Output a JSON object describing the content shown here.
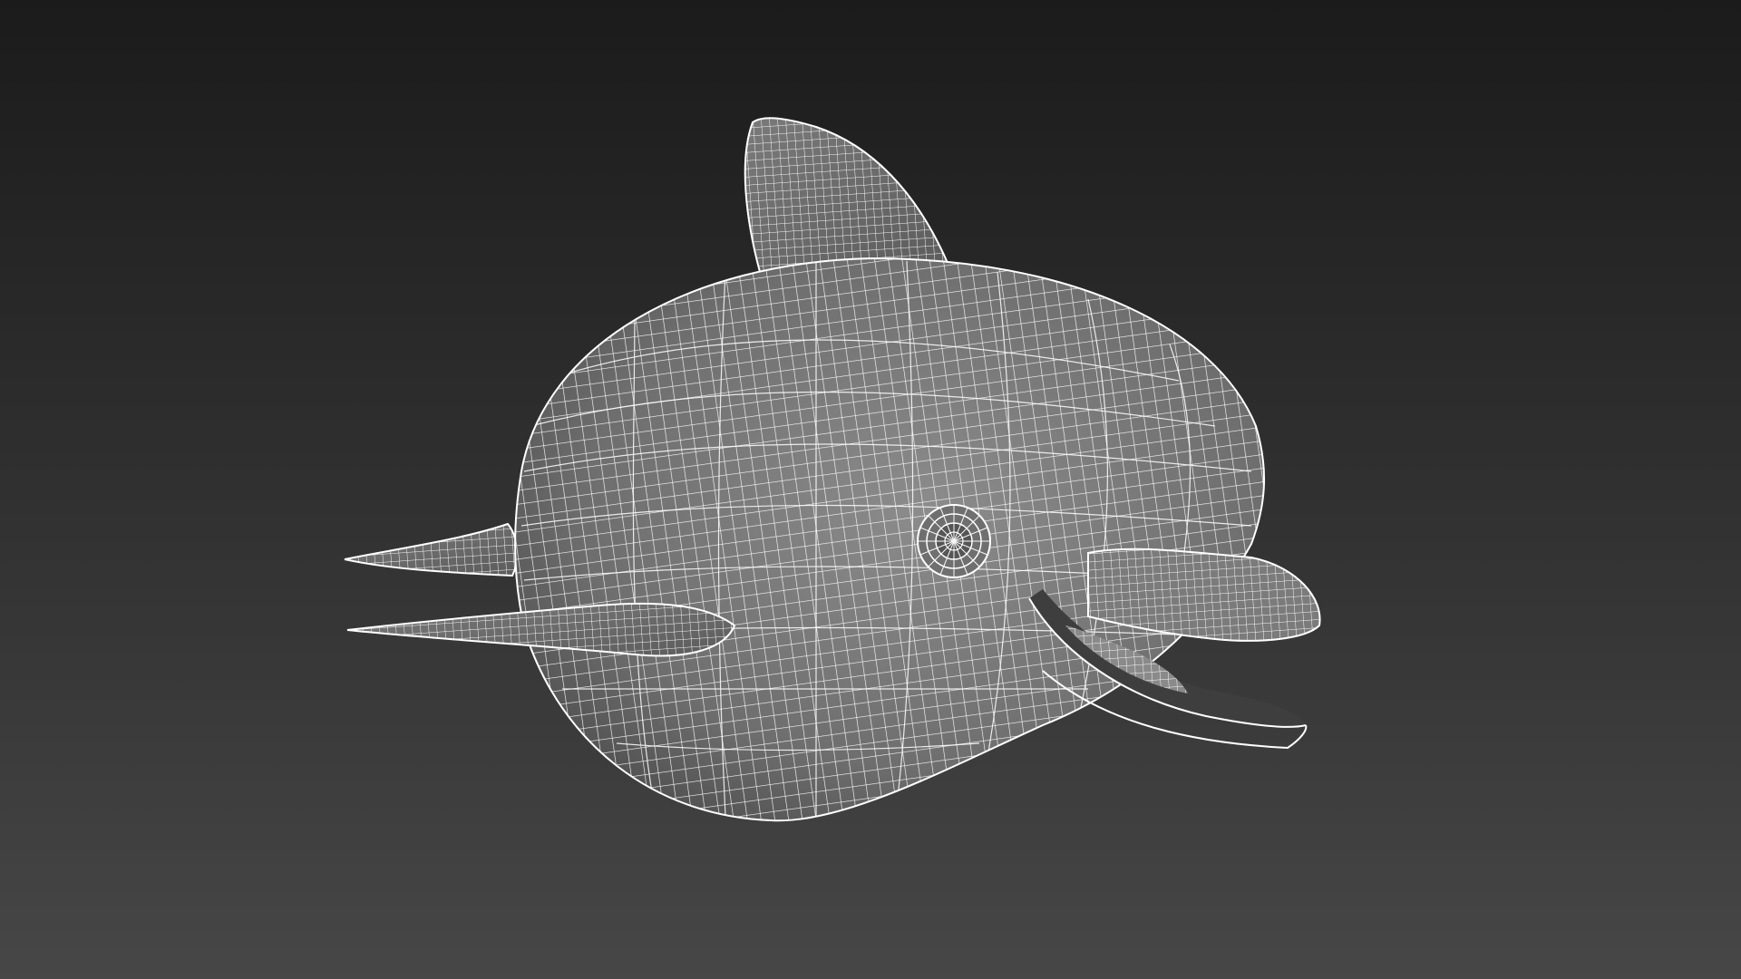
{
  "viewport": {
    "background_top": "#1b1b1b",
    "background_bottom": "#474747",
    "shading": "wireframe-on-shaded"
  },
  "model": {
    "object": "cartoon-dolphin-mesh",
    "mesh_color": "#7d7d7d",
    "wire_color": "#ffffff",
    "view": "perspective-front-right"
  }
}
